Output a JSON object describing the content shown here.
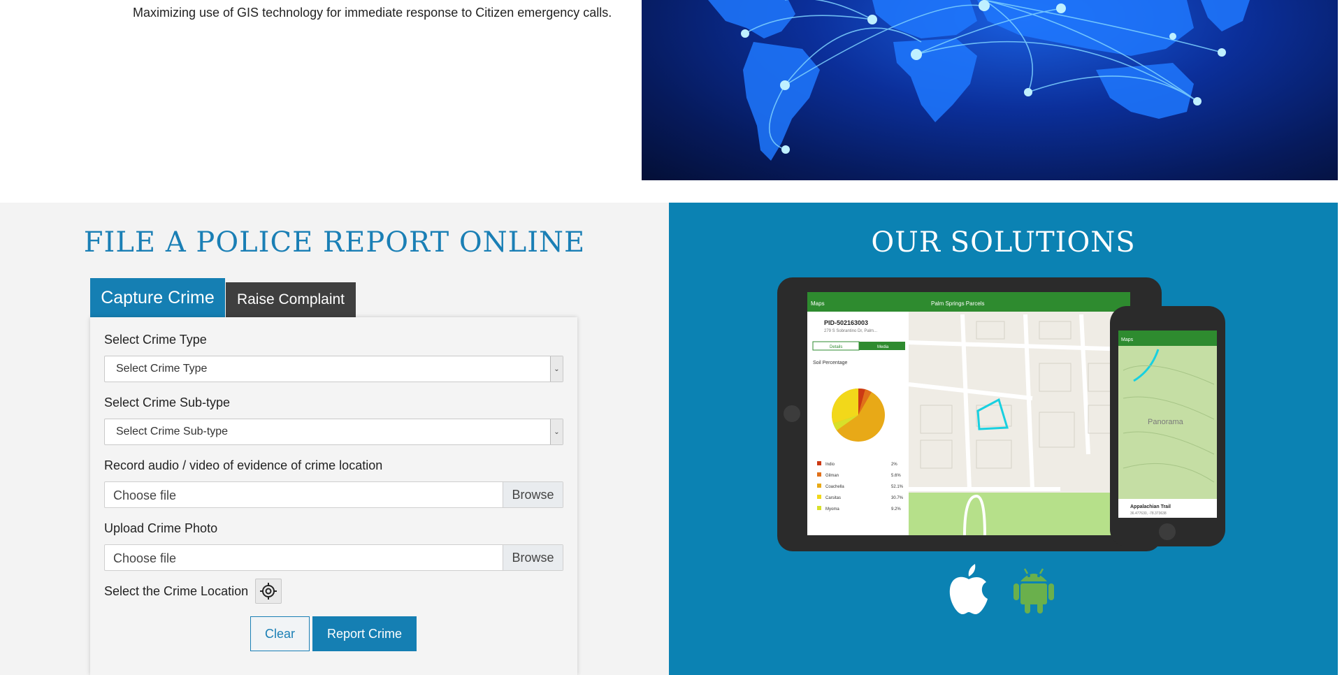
{
  "intro": {
    "text": "Maximizing use of GIS technology for immediate response to Citizen emergency calls."
  },
  "report": {
    "title": "FILE A POLICE REPORT ONLINE",
    "tabs": [
      "Capture Crime",
      "Raise Complaint"
    ],
    "fields": {
      "crime_type_label": "Select Crime Type",
      "crime_type_value": "Select Crime Type",
      "crime_subtype_label": "Select Crime Sub-type",
      "crime_subtype_value": "Select Crime Sub-type",
      "media_label": "Record audio / video of evidence of crime location",
      "media_file": "Choose file",
      "media_browse": "Browse",
      "photo_label": "Upload Crime Photo",
      "photo_file": "Choose file",
      "photo_browse": "Browse",
      "location_label": "Select the Crime Location"
    },
    "buttons": {
      "clear": "Clear",
      "submit": "Report Crime"
    }
  },
  "solutions": {
    "title": "OUR SOLUTIONS",
    "tablet": {
      "back": "Maps",
      "title": "Palm Springs Parcels",
      "parcel_id": "PID-502163003",
      "address": "279 S Sobrantino Dr, Palm...",
      "segments": [
        "Details",
        "Media"
      ],
      "chart_title": "Soil Percentage",
      "legend": [
        {
          "name": "Indio",
          "value": "2%",
          "color": "#cc3a14"
        },
        {
          "name": "Gilman",
          "value": "5.6%",
          "color": "#e0701a"
        },
        {
          "name": "Coachella",
          "value": "52.1%",
          "color": "#e8a917"
        },
        {
          "name": "Carsitas",
          "value": "30.7%",
          "color": "#f2d81a"
        },
        {
          "name": "Myoma",
          "value": "9.2%",
          "color": "#d8e02a"
        }
      ]
    },
    "phone": {
      "back": "Maps",
      "place": "Panorama",
      "card_title": "Appalachian Trail",
      "card_sub": "36.477630, -78.373638"
    },
    "platforms": [
      "apple-icon",
      "android-icon"
    ],
    "colors": {
      "panel": "#0b82b3",
      "accent": "#157fb3",
      "android": "#6ab04c"
    }
  }
}
